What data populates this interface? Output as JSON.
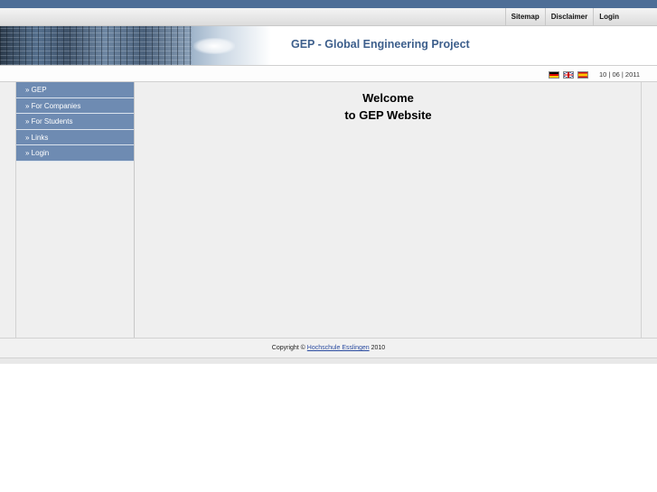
{
  "topnav": {
    "links": [
      "Sitemap",
      "Disclaimer",
      "Login"
    ]
  },
  "header": {
    "title": "GEP - Global Engineering Project"
  },
  "subbar": {
    "flags": [
      "german-flag-icon",
      "uk-flag-icon",
      "spanish-flag-icon"
    ],
    "date": "10 | 06 | 2011"
  },
  "sidebar": {
    "items": [
      {
        "label": "» GEP"
      },
      {
        "label": "» For Companies"
      },
      {
        "label": "» For Students"
      },
      {
        "label": "» Links"
      },
      {
        "label": "» Login"
      }
    ]
  },
  "main": {
    "welcome_line1": "Welcome",
    "welcome_line2": "to GEP Website"
  },
  "footer": {
    "prefix": "Copyright © ",
    "link": "Hochschule Esslingen",
    "suffix": " 2010"
  },
  "colors": {
    "topbar": "#4e6e97",
    "menu": "#6e8bb2",
    "title": "#3d5f8c",
    "content_bg": "#efefef"
  }
}
